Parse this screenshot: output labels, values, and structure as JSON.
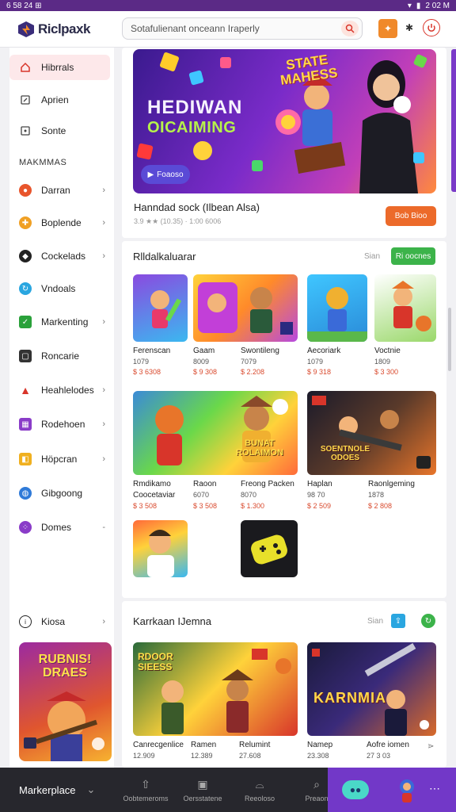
{
  "status": {
    "left": "6 58 24 ⊞",
    "right": "2 02 M"
  },
  "app": {
    "name": "Riclpaxk"
  },
  "search": {
    "placeholder": "Sotafulienant onceann Iraperly"
  },
  "sidebar": {
    "items": [
      {
        "label": "Hibrrals",
        "icon": "home-icon",
        "color": "#d8352a",
        "active": true
      },
      {
        "label": "Aprien",
        "icon": "pen-icon",
        "color": "#444"
      },
      {
        "label": "Sonte",
        "icon": "store-icon",
        "color": "#444"
      }
    ],
    "section_label": "MAKMMAS",
    "categories": [
      {
        "label": "Darran",
        "icon": "circle-icon",
        "color": "#e8552c"
      },
      {
        "label": "Boplende",
        "icon": "gamepad-icon",
        "color": "#f0a024"
      },
      {
        "label": "Cockelads",
        "icon": "controller-icon",
        "color": "#222"
      },
      {
        "label": "Vndoals",
        "icon": "shuffle-icon",
        "color": "#2aa6e0"
      },
      {
        "label": "Markenting",
        "icon": "check-icon",
        "color": "#2aa13a"
      },
      {
        "label": "Roncarie",
        "icon": "square-icon",
        "color": "#333"
      },
      {
        "label": "Heahlelodes",
        "icon": "triangle-icon",
        "color": "#d8352a"
      },
      {
        "label": "Rodehoen",
        "icon": "grid-icon",
        "color": "#8a3cc8"
      },
      {
        "label": "Höpcran",
        "icon": "tag-icon",
        "color": "#f0b020"
      },
      {
        "label": "Gibgoong",
        "icon": "globe-icon",
        "color": "#2f7ad8"
      },
      {
        "label": "Domes",
        "icon": "dice-icon",
        "color": "#8a3cc8"
      }
    ],
    "footer_item": "Kiosa",
    "promo_title": "RUBNIS! DRAES"
  },
  "hero": {
    "title": "HEDIWAN",
    "title2": "OICAIMING",
    "tag": "STATE MAHESS",
    "button": "Foaoso",
    "caption": "Hanndad sock (Ilbean Alsa)",
    "meta": "3.9 ★★ (10.35) · 1:00 6006",
    "cta": "Bob Bioo"
  },
  "section1": {
    "title": "Rlldalkaluarar",
    "meta": "Sian",
    "button": "Ri oocnes",
    "row1": [
      {
        "name": "Ferenscan",
        "rating": "1079",
        "price": "$ 3 6308"
      },
      {
        "name": "Gaam",
        "rating": "8009",
        "price": "$ 9 308"
      },
      {
        "name": "Swontileng",
        "rating": "7079",
        "price": "$ 2.208"
      },
      {
        "name": "Aecoriark",
        "rating": "1079",
        "price": "$ 9 318"
      },
      {
        "name": "Voctnie",
        "rating": "1809",
        "price": "$ 3 300"
      }
    ],
    "row2": [
      {
        "name": "Rmdikamo",
        "name2": "Coocetaviar",
        "rating": "",
        "price": "$ 3 508"
      },
      {
        "name": "Raoon",
        "rating": "6070",
        "price": "$ 3 508"
      },
      {
        "name": "Freong Packen",
        "rating": "8070",
        "price": "$ 1.300"
      },
      {
        "name": "Haplan",
        "rating": "98 70",
        "price": "$ 2 509"
      },
      {
        "name": "Raonlgeming",
        "rating": "1878",
        "price": "$ 2 808"
      }
    ],
    "banner1": "BUNAT ROLAIMON",
    "banner2": "SOENTNOLE ODOES"
  },
  "section2": {
    "title": "Karrkaan IJemna",
    "meta": "Sian",
    "banner1": "RDOOR SIEESS",
    "banner2": "KARNMIA",
    "items": [
      {
        "name": "Canrecgenlice",
        "price": "12.909"
      },
      {
        "name": "Ramen",
        "price": "12.389"
      },
      {
        "name": "Relumint",
        "price": "27.608"
      },
      {
        "name": "Namep",
        "price": "23.308"
      },
      {
        "name": "Aofre iomen",
        "price": "27 3 03"
      }
    ]
  },
  "bottombar": {
    "label": "Markerplace",
    "items": [
      "Oobtemeroms",
      "Oersstatene",
      "Reeoloso",
      "Preaon"
    ]
  }
}
